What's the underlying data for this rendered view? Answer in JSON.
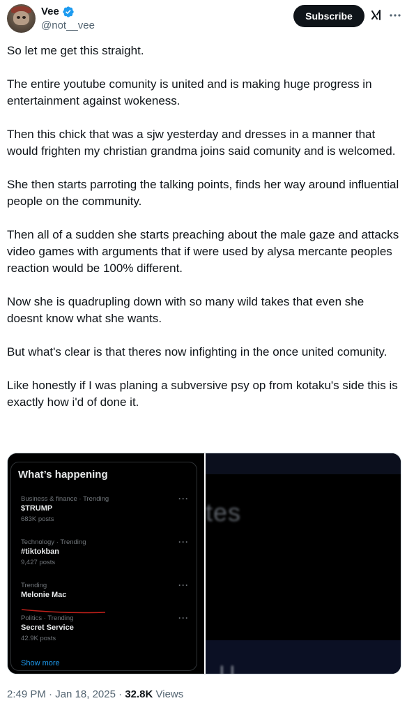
{
  "author": {
    "display_name": "Vee",
    "handle": "@not__vee",
    "verified_icon": "verified-badge-icon",
    "badge_color": "#1d9bf0"
  },
  "header": {
    "subscribe_label": "Subscribe",
    "grok_icon": "grok-icon",
    "more_icon": "more-dots-icon"
  },
  "tweet": {
    "paragraphs": [
      "So let me get this straight.",
      "The entire youtube comunity is united and is making huge progress in entertainment against wokeness.",
      "Then this chick that was a sjw yesterday and dresses in a manner that would frighten my christian grandma joins said comunity and is welcomed.",
      "She then starts parroting the talking points, finds her way around influential people on the community.",
      "Then all of a sudden she starts preaching about the male gaze and attacks video games with arguments that if were used by alysa mercante peoples reaction would be 100% different.",
      "Now she is quadrupling down with so many wild takes that even she doesnt know what she wants.",
      "But what's clear is that theres now infighting in the once united comunity.",
      "Like honestly if I was planing a subversive psy op from kotaku's side this is exactly how i'd of done it."
    ]
  },
  "media": {
    "whats_happening": {
      "title": "What’s happening",
      "trends": [
        {
          "meta": "Business & finance · Trending",
          "name": "$TRUMP",
          "count": "683K posts"
        },
        {
          "meta": "Technology · Trending",
          "name": "#tiktokban",
          "count": "9,427 posts"
        },
        {
          "meta": "Trending",
          "name": "Melonie Mac",
          "count": ""
        },
        {
          "meta": "Politics · Trending",
          "name": "Secret Service",
          "count": "42.9K posts"
        }
      ],
      "show_more": "Show more",
      "dots": "···"
    },
    "right_panel": {
      "blurred_text": "tes",
      "blurred_bottom_text": "l           l"
    }
  },
  "footer": {
    "time": "2:49 PM",
    "separator": "·",
    "date": "Jan 18, 2025",
    "views_count": "32.8K",
    "views_label": "Views"
  }
}
